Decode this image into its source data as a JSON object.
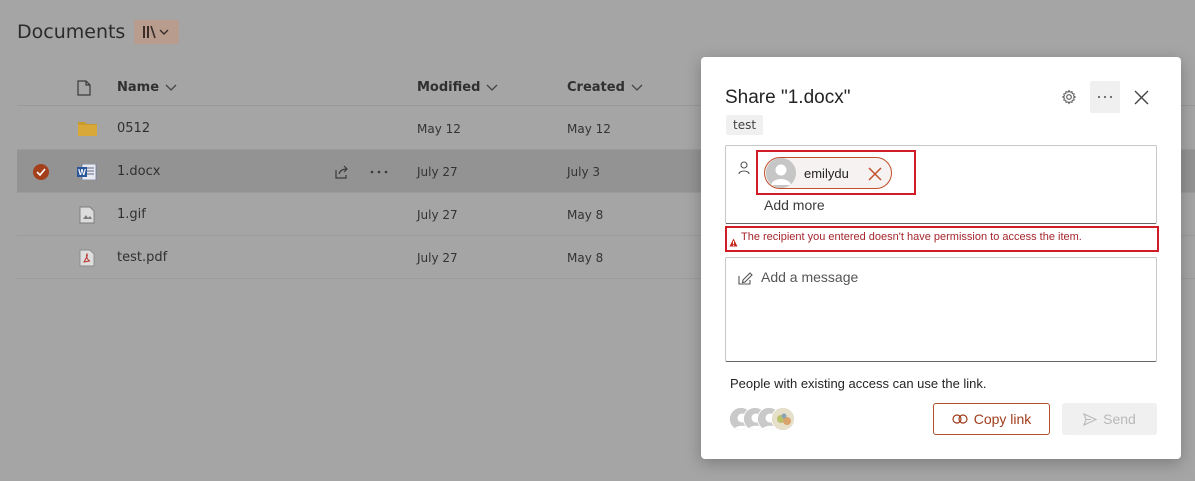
{
  "library": {
    "title": "Documents",
    "view_icon": "library-view-icon",
    "columns": {
      "name": "Name",
      "modified": "Modified",
      "created": "Created"
    },
    "rows": [
      {
        "name": "0512",
        "icon": "folder-icon",
        "modified": "May 12",
        "created": "May 12",
        "selected": false
      },
      {
        "name": "1.docx",
        "icon": "word-doc-icon",
        "modified": "July 27",
        "created": "July 3",
        "selected": true
      },
      {
        "name": "1.gif",
        "icon": "image-file-icon",
        "modified": "July 27",
        "created": "May 8",
        "selected": false
      },
      {
        "name": "test.pdf",
        "icon": "pdf-file-icon",
        "modified": "July 27",
        "created": "May 8",
        "selected": false
      }
    ]
  },
  "dialog": {
    "title": "Share \"1.docx\"",
    "tag": "test",
    "recipient": {
      "name": "emilydu"
    },
    "add_more": "Add more",
    "warning": "The recipient you entered doesn't have permission to access the item.",
    "message_placeholder": "Add a message",
    "access_text": "People with existing access can use the link.",
    "copy_link": "Copy link",
    "send": "Send"
  },
  "colors": {
    "accent": "#a13d1b",
    "warning_red": "#d01c24",
    "overlay_bg": "#a5a5a5"
  }
}
